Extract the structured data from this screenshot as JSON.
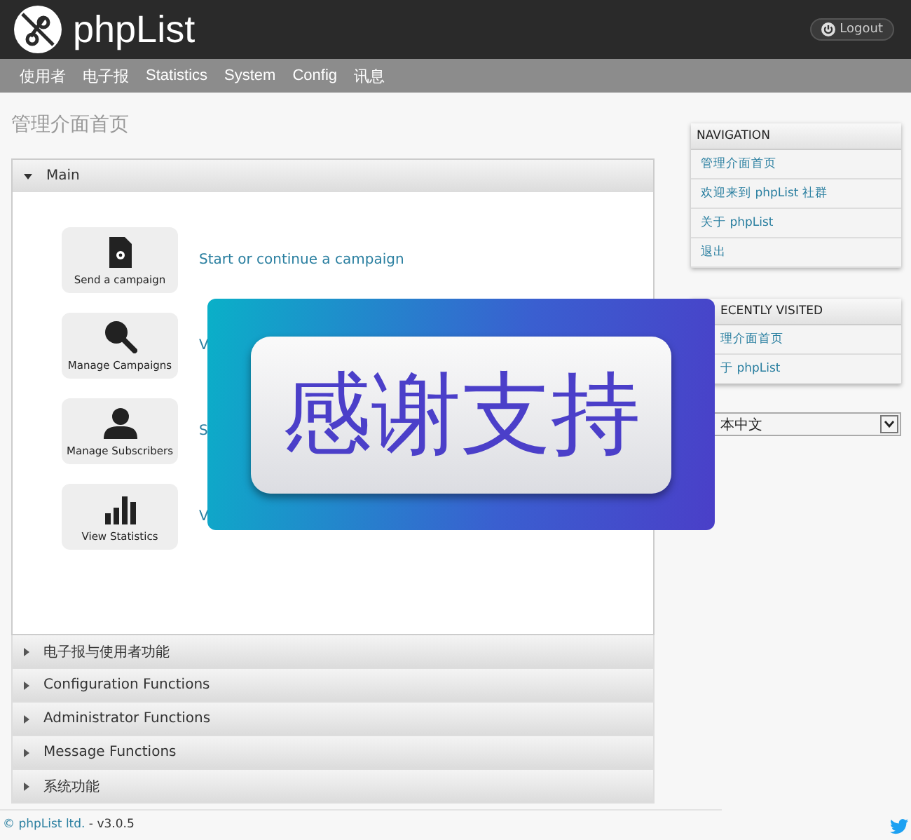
{
  "header": {
    "brand": "phpList",
    "logout": "Logout"
  },
  "menu": [
    {
      "label": "使用者"
    },
    {
      "label": "电子报"
    },
    {
      "label": "Statistics"
    },
    {
      "label": "System"
    },
    {
      "label": "Config"
    },
    {
      "label": "讯息"
    }
  ],
  "page_title": "管理介面首页",
  "main_panel": {
    "title": "Main",
    "expanded": true,
    "actions": [
      {
        "kind": "send",
        "label": "Send a campaign",
        "description": "Start or continue a campaign"
      },
      {
        "kind": "search",
        "label": "Manage Campaigns",
        "description": "V"
      },
      {
        "kind": "person",
        "label": "Manage Subscribers",
        "description": "S"
      },
      {
        "kind": "chart",
        "label": "View Statistics",
        "description": "V"
      }
    ]
  },
  "sections": [
    {
      "title": "电子报与使用者功能",
      "expanded": false
    },
    {
      "title": "Configuration Functions",
      "expanded": false
    },
    {
      "title": "Administrator Functions",
      "expanded": false
    },
    {
      "title": "Message Functions",
      "expanded": false
    },
    {
      "title": "系统功能",
      "expanded": false
    }
  ],
  "navigation": {
    "title": "NAVIGATION",
    "items": [
      "管理介面首页",
      "欢迎来到 phpList 社群",
      "关于 phpList",
      "退出"
    ]
  },
  "recently_visited": {
    "title": "ECENTLY VISITED",
    "items": [
      "理介面首页",
      "于 phpList"
    ]
  },
  "language_select": {
    "value": "本中文"
  },
  "overlay": {
    "text": "感谢支持"
  },
  "footer": {
    "link": "© phpList ltd.",
    "version": " - v3.0.5"
  }
}
